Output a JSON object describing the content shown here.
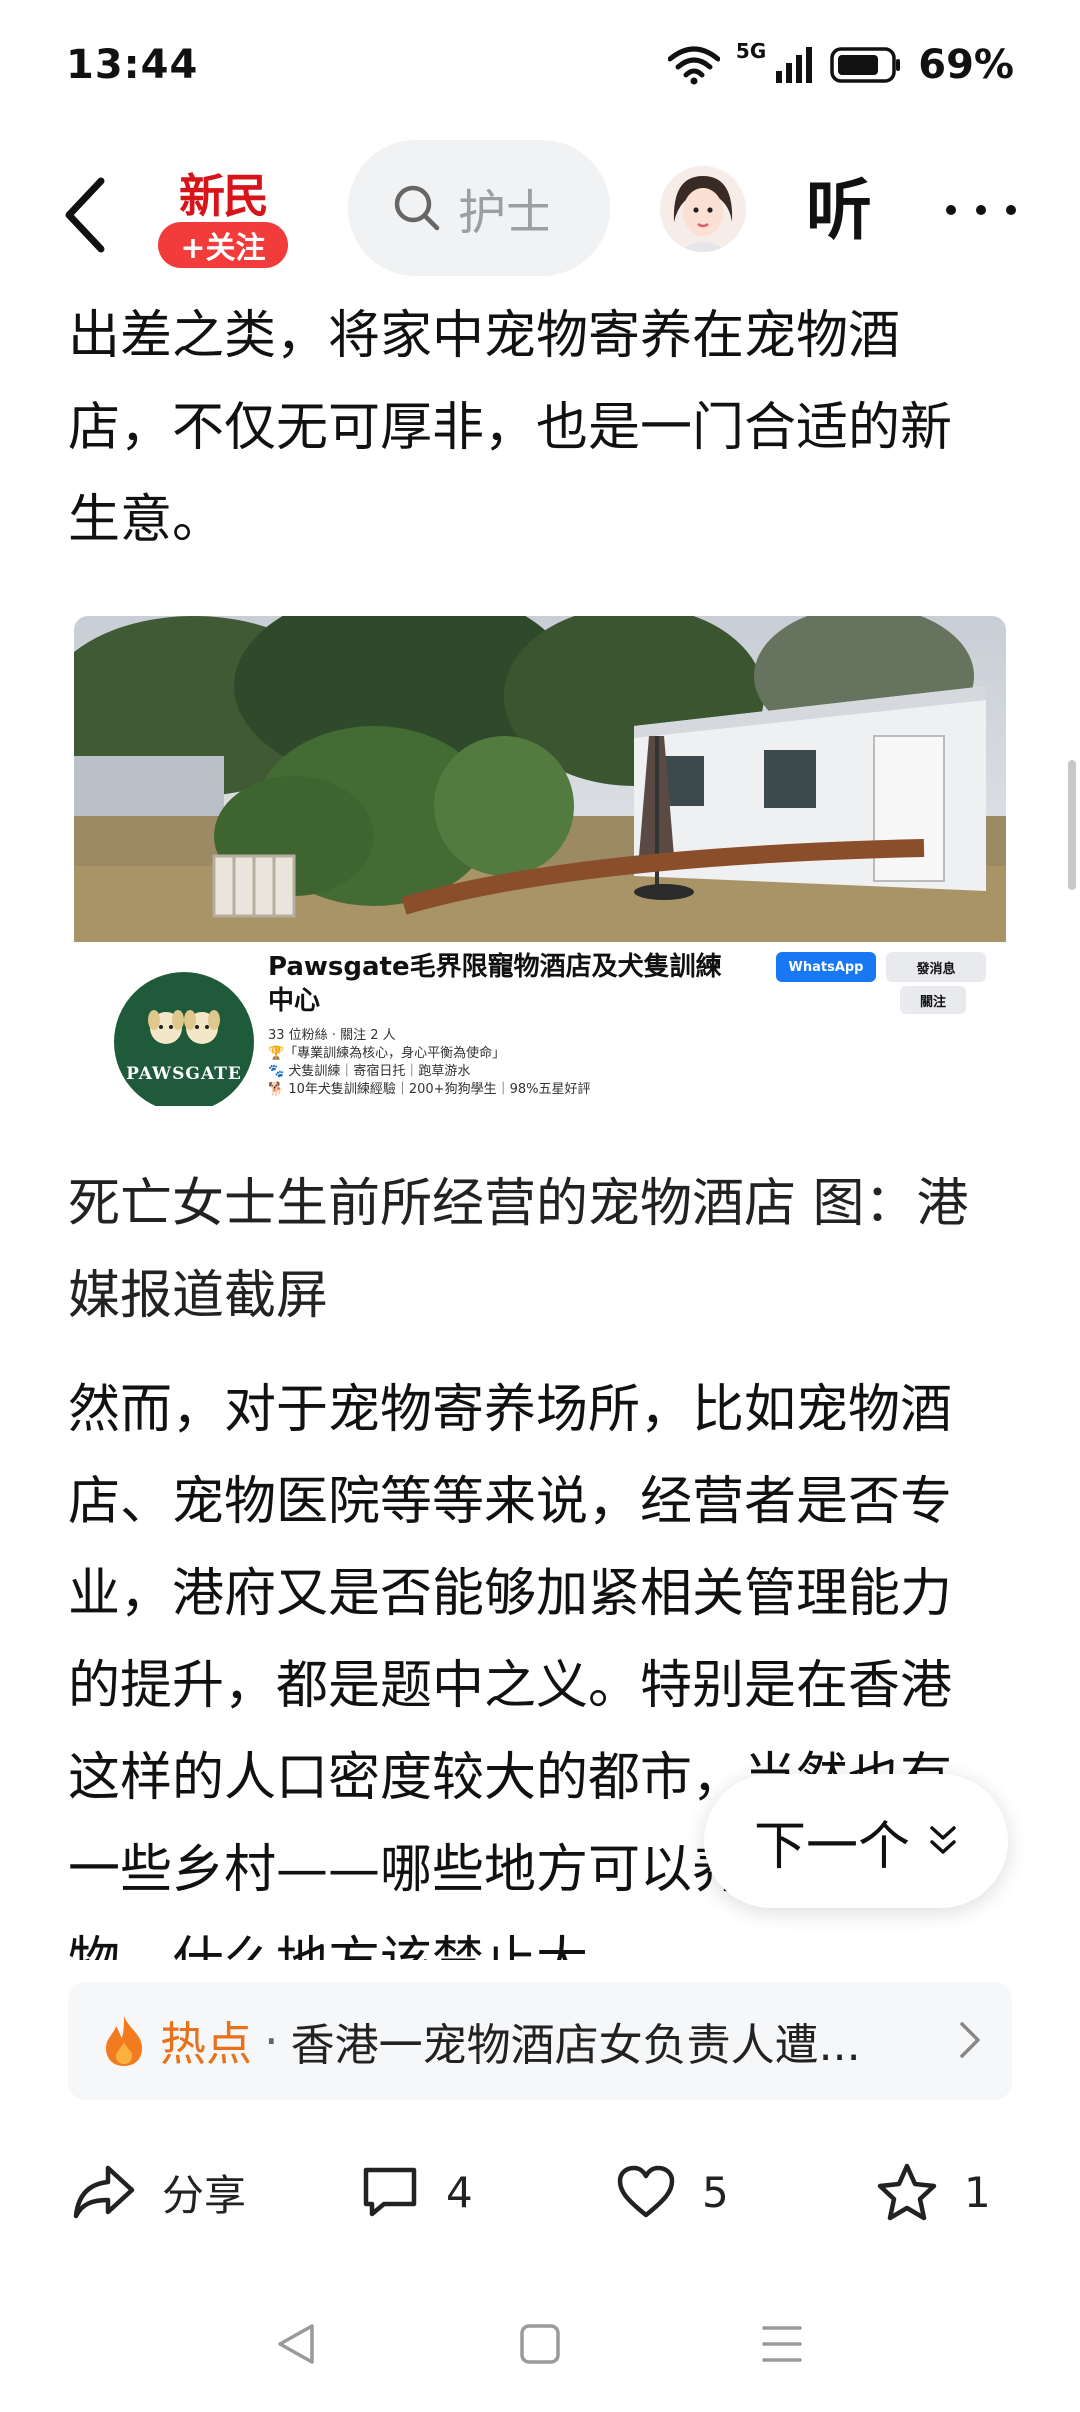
{
  "status_bar": {
    "time": "13:44",
    "network": "5G",
    "battery": "69%"
  },
  "top_nav": {
    "brand_logo_text": "新民",
    "follow_label": "+关注",
    "search_placeholder": "护士",
    "listen_label": "听"
  },
  "article": {
    "para1": "出差之类，将家中宠物寄养在宠物酒店，不仅无可厚非，也是一门合适的新生意。",
    "image": {
      "business_name": "Pawsgate毛界限寵物酒店及犬隻訓練中心",
      "logo_text": "PAWSGATE",
      "followers_line": "33 位粉絲 · 關注 2 人",
      "info_line_1": "🏆「專業訓練為核心，身心平衡為使命」",
      "info_line_2": "🐾 犬隻訓練｜寄宿日托｜跑草游水",
      "info_line_3": "🐕 10年犬隻訓練經驗｜200+狗狗學生｜98%五星好評",
      "whatsapp_label": "WhatsApp",
      "message_label": "發消息",
      "follow_label": "關注"
    },
    "caption": "死亡女士生前所经营的宠物酒店 图：港媒报道截屏",
    "para2": "然而，对于宠物寄养场所，比如宠物酒店、宠物医院等等来说，经营者是否专业，港府又是否能够加紧相关管理能力的提升，都是题中之义。特别是在香港这样的人口密度较大的都市，当然也有一些乡村——哪些地方可以养大型宠物，什么地方该禁止大"
  },
  "next_button": {
    "label": "下一个"
  },
  "hot_bar": {
    "tag": "热点",
    "separator": "·",
    "text": "香港一宠物酒店女负责人遭..."
  },
  "actions": {
    "share_label": "分享",
    "comment_count": "4",
    "like_count": "5",
    "favorite_count": "1"
  },
  "colors": {
    "accent_red": "#f23b3b",
    "hot_orange": "#e8711c"
  }
}
